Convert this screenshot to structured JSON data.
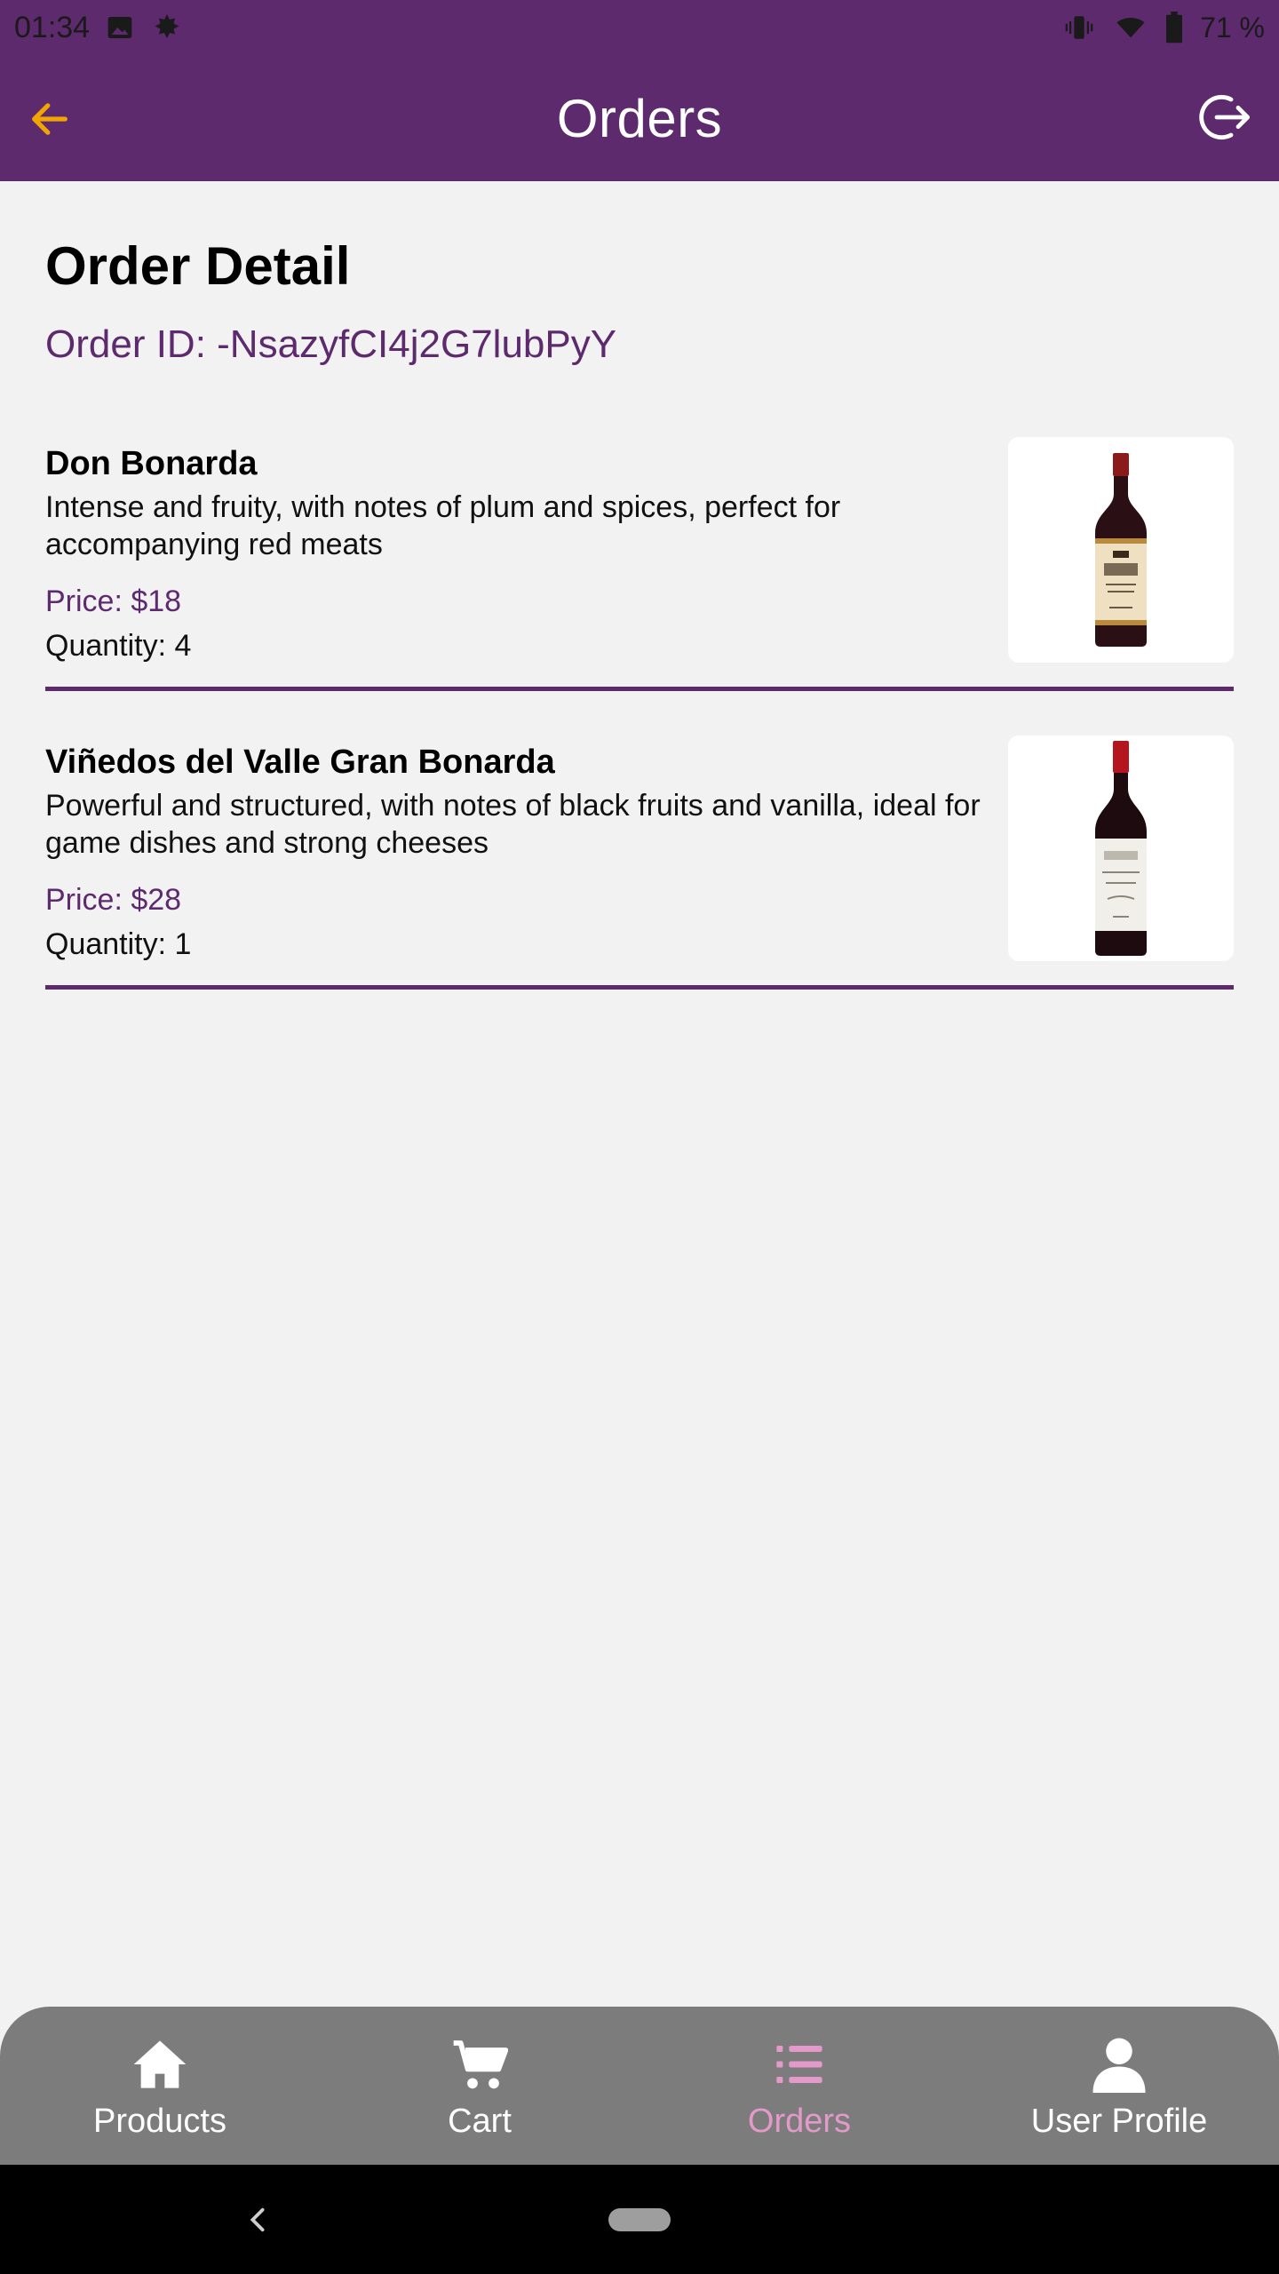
{
  "status_bar": {
    "time": "01:34",
    "battery": "71 %",
    "icons": [
      "image-icon",
      "leaf-icon",
      "vibrate-icon",
      "wifi-icon",
      "battery-icon"
    ]
  },
  "app_bar": {
    "title": "Orders",
    "back_icon": "arrow-left-icon",
    "logout_icon": "logout-icon",
    "color": "#5e2a6e",
    "back_icon_color": "#f0a500"
  },
  "page": {
    "title": "Order Detail",
    "order_id": "Order ID: -NsazyfCI4j2G7lubPyY"
  },
  "items": [
    {
      "name": "Don Bonarda",
      "description": "Intense and fruity, with notes of plum and spices, perfect for accompanying red meats",
      "price": "Price: $18",
      "quantity": "Quantity: 4",
      "image": "wine-bottle-image"
    },
    {
      "name": "Viñedos del Valle Gran Bonarda",
      "description": "Powerful and structured, with notes of black fruits and vanilla, ideal for game dishes and strong cheeses",
      "price": "Price: $28",
      "quantity": "Quantity: 1",
      "image": "wine-bottle-image"
    }
  ],
  "bottom_nav": {
    "items": [
      {
        "label": "Products",
        "icon": "home-icon",
        "active": false
      },
      {
        "label": "Cart",
        "icon": "cart-icon",
        "active": false
      },
      {
        "label": "Orders",
        "icon": "list-icon",
        "active": true
      },
      {
        "label": "User Profile",
        "icon": "person-icon",
        "active": false
      }
    ],
    "active_color": "#e399c9"
  },
  "colors": {
    "accent": "#5e2a6e",
    "background": "#f2f2f2",
    "nav_background": "#7c7c7c"
  }
}
